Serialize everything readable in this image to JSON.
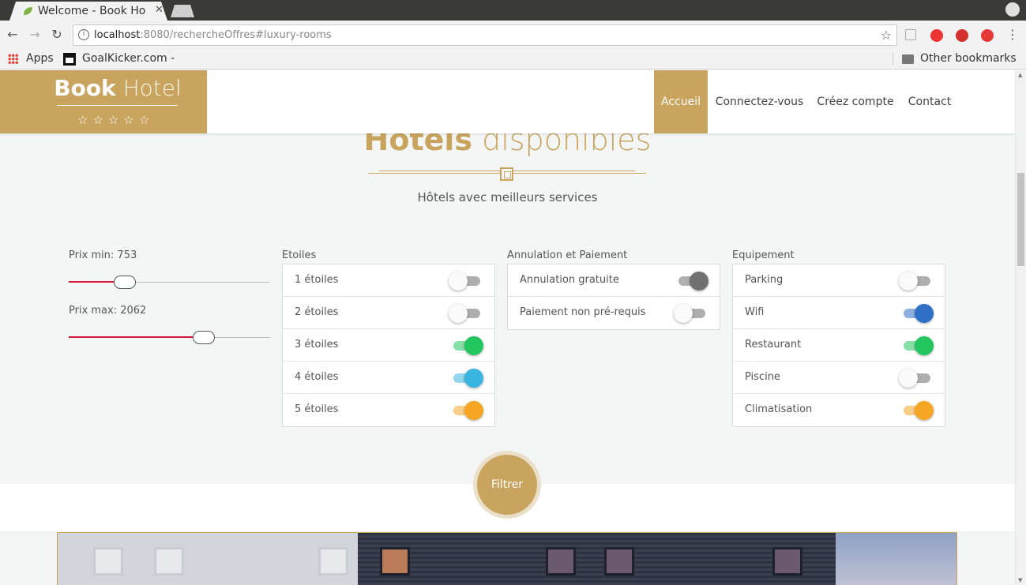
{
  "browser": {
    "tab_title": "Welcome - Book Ho",
    "url_host": "localhost",
    "url_rest": ":8080/rechercheOffres#luxury-rooms",
    "bookmarks": [
      {
        "label": "Apps"
      },
      {
        "label": "GoalKicker.com -"
      }
    ],
    "other_bookmarks": "Other bookmarks"
  },
  "site": {
    "logo_bold": "Book",
    "logo_light": " Hotel",
    "logo_stars": "☆☆☆☆☆",
    "nav": [
      {
        "label": "Accueil",
        "active": true
      },
      {
        "label": "Connectez-vous",
        "active": false
      },
      {
        "label": "Créez compte",
        "active": false
      },
      {
        "label": "Contact",
        "active": false
      }
    ]
  },
  "section": {
    "title_bold": "Hotels",
    "title_light": " disponibles",
    "subtitle": "Hôtels avec meilleurs services"
  },
  "price": {
    "min_label": "Prix min: 753",
    "max_label": "Prix max: 2062",
    "min_fraction": 0.28,
    "max_fraction": 0.67
  },
  "groups": {
    "etoiles": {
      "label": "Etoiles",
      "items": [
        {
          "label": "1 étoiles",
          "on": false,
          "color": "#aeaeae"
        },
        {
          "label": "2 étoiles",
          "on": false,
          "color": "#aeaeae"
        },
        {
          "label": "3 étoiles",
          "on": true,
          "color": "#22c55e"
        },
        {
          "label": "4 étoiles",
          "on": true,
          "color": "#3ab4e0"
        },
        {
          "label": "5 étoiles",
          "on": true,
          "color": "#f5a623"
        }
      ]
    },
    "annulation": {
      "label": "Annulation et Paiement",
      "items": [
        {
          "label": "Annulation gratuite",
          "on": true,
          "color": "#707070"
        },
        {
          "label": "Paiement non pré-requis",
          "on": false,
          "color": "#aeaeae"
        }
      ]
    },
    "equipement": {
      "label": "Equipement",
      "items": [
        {
          "label": "Parking",
          "on": false,
          "color": "#aeaeae"
        },
        {
          "label": "Wifi",
          "on": true,
          "color": "#2f6fc6"
        },
        {
          "label": "Restaurant",
          "on": true,
          "color": "#22c55e"
        },
        {
          "label": "Piscine",
          "on": false,
          "color": "#aeaeae"
        },
        {
          "label": "Climatisation",
          "on": true,
          "color": "#f5a623"
        }
      ]
    }
  },
  "filter_button": "Filtrer",
  "colors": {
    "brand_gold": "#c8a45f",
    "slider_red": "#d4143b"
  }
}
